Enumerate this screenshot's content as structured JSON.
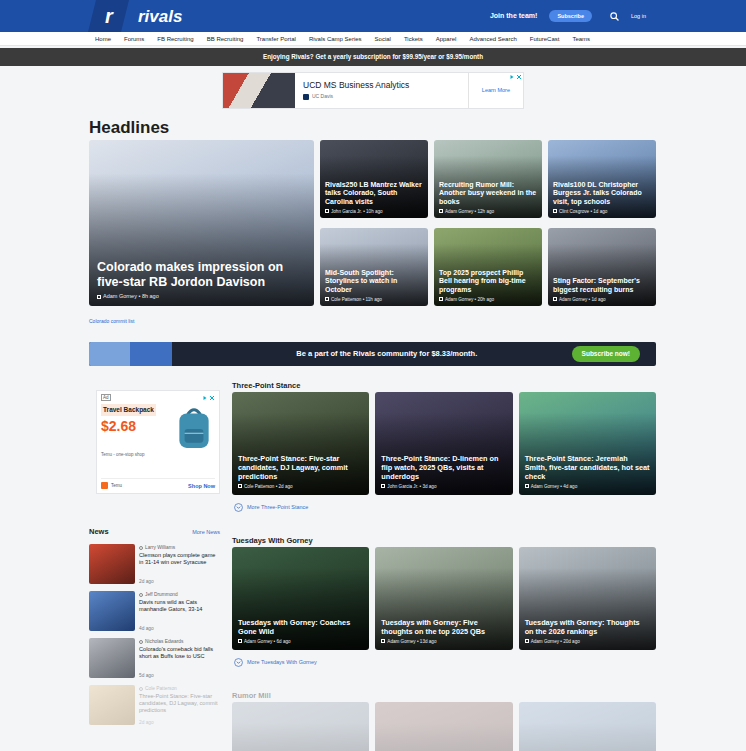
{
  "header": {
    "logo_mark": "r",
    "brand": "rivals",
    "join": "Join the team!",
    "subscribe": "Subscribe",
    "login": "Log in"
  },
  "nav": [
    "Home",
    "Forums",
    "FB Recruiting",
    "BB Recruiting",
    "Transfer Portal",
    "Rivals Camp Series",
    "Social",
    "Tickets",
    "Apparel",
    "Advanced Search",
    "FutureCast",
    "Teams"
  ],
  "promo_bar": {
    "text": "Enjoying Rivals? Get a yearly subscription for $99.95/year or $9.95/month"
  },
  "ad_banner": {
    "title": "UCD MS Business Analytics",
    "sponsor": "UC Davis",
    "cta": "Learn More"
  },
  "headlines": {
    "title": "Headlines",
    "items": [
      {
        "title": "Colorado makes impression on five-star RB Jordon Davison",
        "meta": "Adam Gorney • 8h ago"
      },
      {
        "title": "Rivals250 LB Mantrez Walker talks Colorado, South Carolina visits",
        "meta": "John Garcia Jr. • 10h ago"
      },
      {
        "title": "Recruiting Rumor Mill: Another busy weekend in the books",
        "meta": "Adam Gorney • 12h ago"
      },
      {
        "title": "Rivals100 DL Christopher Burgess Jr. talks Colorado visit, top schools",
        "meta": "Clint Cosgrove • 1d ago"
      },
      {
        "title": "Mid-South Spotlight: Storylines to watch in October",
        "meta": "Cole Patterson • 11h ago"
      },
      {
        "title": "Top 2025 prospect Phillip Bell hearing from big-time programs",
        "meta": "Adam Gorney • 20h ago"
      },
      {
        "title": "Sting Factor: September's biggest recruiting burns",
        "meta": "Adam Gorney • 1d ago"
      }
    ],
    "link": "Colorado commit list"
  },
  "subscribe_banner": {
    "text": "Be a part of the Rivals community for $8.33/month.",
    "button": "Subscribe now!"
  },
  "side_ad": {
    "label": "Ad",
    "title": "Travel Backpack",
    "price": "$2.68",
    "tagline": "Temu - one-stop shop",
    "brand": "Temu",
    "cta": "Shop Now"
  },
  "sections": [
    {
      "title": "Three-Point Stance",
      "faded": false,
      "more": "More Three-Point Stance",
      "cards": [
        {
          "title": "Three-Point Stance: Five-star candidates, DJ Lagway, commit predictions",
          "meta": "Cole Patterson • 2d ago",
          "faded": false
        },
        {
          "title": "Three-Point Stance: D-linemen on flip watch, 2025 QBs, visits at underdogs",
          "meta": "John Garcia Jr. • 3d ago",
          "faded": false
        },
        {
          "title": "Three-Point Stance: Jeremiah Smith, five-star candidates, hot seat check",
          "meta": "Adam Gorney • 4d ago",
          "faded": false
        }
      ]
    },
    {
      "title": "Tuesdays With Gorney",
      "faded": false,
      "more": "More Tuesdays With Gorney",
      "cards": [
        {
          "title": "Tuesdays with Gorney: Coaches Gone Wild",
          "meta": "Adam Gorney • 6d ago",
          "faded": false
        },
        {
          "title": "Tuesdays with Gorney: Five thoughts on the top 2025 QBs",
          "meta": "Adam Gorney • 13d ago",
          "faded": false
        },
        {
          "title": "Tuesdays with Gorney: Thoughts on the 2026 rankings",
          "meta": "Adam Gorney • 20d ago",
          "faded": false
        }
      ]
    },
    {
      "title": "Rumor Mill",
      "faded": true,
      "cards": [
        {
          "faded": true
        },
        {
          "faded": true
        },
        {
          "faded": true
        }
      ]
    }
  ],
  "news": {
    "title": "News",
    "more": "More News",
    "items": [
      {
        "author": "Larry Williams",
        "title": "Clemson plays complete game in 31-14 win over Syracuse",
        "time": "2d ago",
        "faded": false
      },
      {
        "author": "Jeff Drummond",
        "title": "Davis runs wild as Cats manhandle Gators, 33-14",
        "time": "4d ago",
        "faded": false
      },
      {
        "author": "Nicholas Edwards",
        "title": "Colorado's comeback bid falls short as Buffs lose to USC",
        "time": "5d ago",
        "faded": false
      },
      {
        "author": "Cole Patterson",
        "title": "Three-Point Stance: Five-star candidates, DJ Lagway, commit predictions",
        "time": "2d ago",
        "faded": true
      }
    ]
  }
}
